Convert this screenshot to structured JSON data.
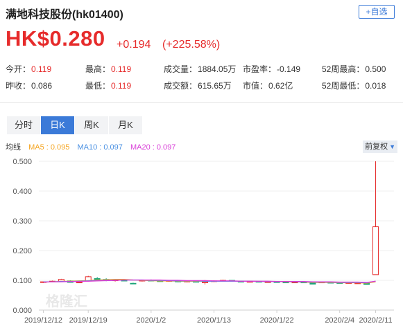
{
  "header": {
    "title": "满地科技股份(hk01400)",
    "add_button": "+自选"
  },
  "quote": {
    "price": "HK$0.280",
    "change": "+0.194",
    "change_pct": "(+225.58%)"
  },
  "stats": [
    {
      "label": "今开：",
      "value": "0.119",
      "color": "red"
    },
    {
      "label": "最高：",
      "value": "0.119",
      "color": "red"
    },
    {
      "label": "成交量：",
      "value": "1884.05万",
      "color": "dark"
    },
    {
      "label": "市盈率：",
      "value": "-0.149",
      "color": "dark"
    },
    {
      "label": "52周最高：",
      "value": "0.500",
      "color": "dark"
    },
    {
      "label": "昨收：",
      "value": "0.086",
      "color": "dark"
    },
    {
      "label": "最低：",
      "value": "0.119",
      "color": "red"
    },
    {
      "label": "成交额：",
      "value": "615.65万",
      "color": "dark"
    },
    {
      "label": "市值：",
      "value": "0.62亿",
      "color": "dark"
    },
    {
      "label": "52周最低：",
      "value": "0.018",
      "color": "dark"
    }
  ],
  "tabs": [
    {
      "label": "分时",
      "active": false
    },
    {
      "label": "日K",
      "active": true
    },
    {
      "label": "周K",
      "active": false
    },
    {
      "label": "月K",
      "active": false
    }
  ],
  "ma_legend": {
    "label": "均线",
    "ma5": "MA5 : 0.095",
    "ma10": "MA10 : 0.097",
    "ma20": "MA20 : 0.097",
    "adjust": "前复权"
  },
  "colors": {
    "up": "#e62b2b",
    "down": "#1fa67a",
    "ma5": "#f5a623",
    "ma10": "#4a90e2",
    "ma20": "#d93fd8",
    "accent": "#3b7ad8"
  },
  "watermark": "格隆汇",
  "chart_data": {
    "type": "candlestick",
    "ylim": [
      0.0,
      0.5
    ],
    "y_ticks": [
      "0.500",
      "0.400",
      "0.300",
      "0.200",
      "0.100",
      "0.000"
    ],
    "x_ticks": [
      "2019/12/12",
      "2019/12/19",
      "2020/1/2",
      "2020/1/13",
      "2020/1/22",
      "2020/2/4",
      "2020/2/11"
    ],
    "x_tick_index": [
      0,
      5,
      12,
      19,
      26,
      33,
      37
    ],
    "candles": [
      {
        "o": 0.093,
        "h": 0.096,
        "l": 0.091,
        "c": 0.095
      },
      {
        "o": 0.095,
        "h": 0.099,
        "l": 0.093,
        "c": 0.097
      },
      {
        "o": 0.097,
        "h": 0.105,
        "l": 0.095,
        "c": 0.103
      },
      {
        "o": 0.098,
        "h": 0.1,
        "l": 0.092,
        "c": 0.093
      },
      {
        "o": 0.093,
        "h": 0.098,
        "l": 0.091,
        "c": 0.094
      },
      {
        "o": 0.098,
        "h": 0.115,
        "l": 0.097,
        "c": 0.112
      },
      {
        "o": 0.106,
        "h": 0.111,
        "l": 0.1,
        "c": 0.103
      },
      {
        "o": 0.103,
        "h": 0.107,
        "l": 0.097,
        "c": 0.099
      },
      {
        "o": 0.099,
        "h": 0.103,
        "l": 0.096,
        "c": 0.101
      },
      {
        "o": 0.1,
        "h": 0.102,
        "l": 0.097,
        "c": 0.099
      },
      {
        "o": 0.09,
        "h": 0.092,
        "l": 0.088,
        "c": 0.089
      },
      {
        "o": 0.098,
        "h": 0.102,
        "l": 0.096,
        "c": 0.1
      },
      {
        "o": 0.1,
        "h": 0.103,
        "l": 0.097,
        "c": 0.098
      },
      {
        "o": 0.098,
        "h": 0.101,
        "l": 0.095,
        "c": 0.097
      },
      {
        "o": 0.097,
        "h": 0.1,
        "l": 0.095,
        "c": 0.099
      },
      {
        "o": 0.097,
        "h": 0.099,
        "l": 0.093,
        "c": 0.095
      },
      {
        "o": 0.095,
        "h": 0.099,
        "l": 0.093,
        "c": 0.097
      },
      {
        "o": 0.096,
        "h": 0.099,
        "l": 0.093,
        "c": 0.095
      },
      {
        "o": 0.092,
        "h": 0.101,
        "l": 0.086,
        "c": 0.095
      },
      {
        "o": 0.096,
        "h": 0.1,
        "l": 0.094,
        "c": 0.098
      },
      {
        "o": 0.098,
        "h": 0.102,
        "l": 0.096,
        "c": 0.1
      },
      {
        "o": 0.1,
        "h": 0.101,
        "l": 0.096,
        "c": 0.097
      },
      {
        "o": 0.097,
        "h": 0.098,
        "l": 0.093,
        "c": 0.094
      },
      {
        "o": 0.094,
        "h": 0.097,
        "l": 0.093,
        "c": 0.096
      },
      {
        "o": 0.096,
        "h": 0.097,
        "l": 0.093,
        "c": 0.094
      },
      {
        "o": 0.094,
        "h": 0.096,
        "l": 0.093,
        "c": 0.095
      },
      {
        "o": 0.095,
        "h": 0.097,
        "l": 0.093,
        "c": 0.094
      },
      {
        "o": 0.094,
        "h": 0.096,
        "l": 0.092,
        "c": 0.093
      },
      {
        "o": 0.093,
        "h": 0.095,
        "l": 0.091,
        "c": 0.094
      },
      {
        "o": 0.094,
        "h": 0.095,
        "l": 0.092,
        "c": 0.093
      },
      {
        "o": 0.093,
        "h": 0.094,
        "l": 0.086,
        "c": 0.087
      },
      {
        "o": 0.092,
        "h": 0.095,
        "l": 0.091,
        "c": 0.094
      },
      {
        "o": 0.093,
        "h": 0.094,
        "l": 0.091,
        "c": 0.092
      },
      {
        "o": 0.092,
        "h": 0.093,
        "l": 0.09,
        "c": 0.091
      },
      {
        "o": 0.091,
        "h": 0.093,
        "l": 0.089,
        "c": 0.092
      },
      {
        "o": 0.091,
        "h": 0.092,
        "l": 0.09,
        "c": 0.091
      },
      {
        "o": 0.09,
        "h": 0.091,
        "l": 0.085,
        "c": 0.086
      },
      {
        "o": 0.119,
        "h": 0.5,
        "l": 0.119,
        "c": 0.28
      }
    ],
    "ma5": [
      0.094,
      0.095,
      0.096,
      0.097,
      0.098,
      0.099,
      0.101,
      0.102,
      0.103,
      0.103,
      0.101,
      0.1,
      0.099,
      0.098,
      0.098,
      0.097,
      0.097,
      0.097,
      0.097,
      0.097,
      0.097,
      0.097,
      0.097,
      0.097,
      0.096,
      0.096,
      0.096,
      0.095,
      0.095,
      0.094,
      0.093,
      0.093,
      0.093,
      0.092,
      0.092,
      0.092,
      0.091,
      0.095
    ],
    "ma10": [
      0.095,
      0.095,
      0.096,
      0.096,
      0.097,
      0.098,
      0.099,
      0.1,
      0.101,
      0.101,
      0.101,
      0.101,
      0.1,
      0.1,
      0.099,
      0.098,
      0.098,
      0.098,
      0.097,
      0.097,
      0.097,
      0.097,
      0.097,
      0.097,
      0.096,
      0.096,
      0.096,
      0.096,
      0.095,
      0.095,
      0.094,
      0.094,
      0.094,
      0.093,
      0.093,
      0.093,
      0.092,
      0.097
    ],
    "ma20": [
      0.094,
      0.095,
      0.095,
      0.096,
      0.096,
      0.097,
      0.098,
      0.099,
      0.1,
      0.101,
      0.101,
      0.101,
      0.101,
      0.101,
      0.1,
      0.1,
      0.099,
      0.099,
      0.099,
      0.098,
      0.098,
      0.098,
      0.097,
      0.097,
      0.097,
      0.097,
      0.096,
      0.096,
      0.096,
      0.096,
      0.095,
      0.095,
      0.095,
      0.094,
      0.094,
      0.094,
      0.093,
      0.097
    ]
  }
}
